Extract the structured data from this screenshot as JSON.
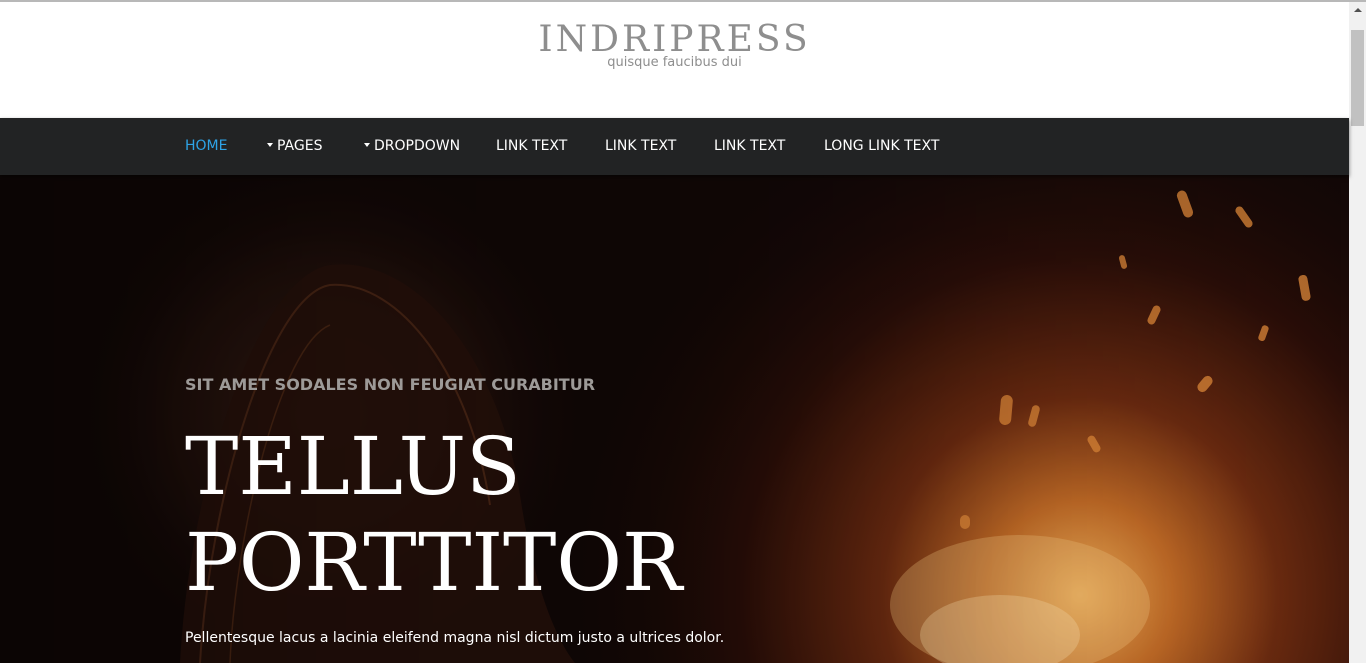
{
  "header": {
    "site_title": "INDRIPRESS",
    "tagline": "quisque faucibus dui"
  },
  "nav": {
    "items": [
      {
        "label": "HOME",
        "active": true,
        "dropdown": false
      },
      {
        "label": "PAGES",
        "active": false,
        "dropdown": true
      },
      {
        "label": "DROPDOWN",
        "active": false,
        "dropdown": true
      },
      {
        "label": "LINK TEXT",
        "active": false,
        "dropdown": false
      },
      {
        "label": "LINK TEXT",
        "active": false,
        "dropdown": false
      },
      {
        "label": "LINK TEXT",
        "active": false,
        "dropdown": false
      },
      {
        "label": "LONG LINK TEXT",
        "active": false,
        "dropdown": false
      }
    ]
  },
  "hero": {
    "kicker": "SIT AMET SODALES NON FEUGIAT CURABITUR",
    "title_line1": "TELLUS",
    "title_line2": "PORTTITOR",
    "body": "Pellentesque lacus a lacinia eleifend magna nisl dictum justo a ultrices dolor."
  },
  "colors": {
    "nav_background": "#222324",
    "nav_active": "#2ea3e6",
    "header_text": "#8e8e8e",
    "hero_kicker": "#9d9a98"
  },
  "icons": {
    "dropdown_caret": "caret-down-icon",
    "scroll_up": "chevron-up-icon"
  }
}
